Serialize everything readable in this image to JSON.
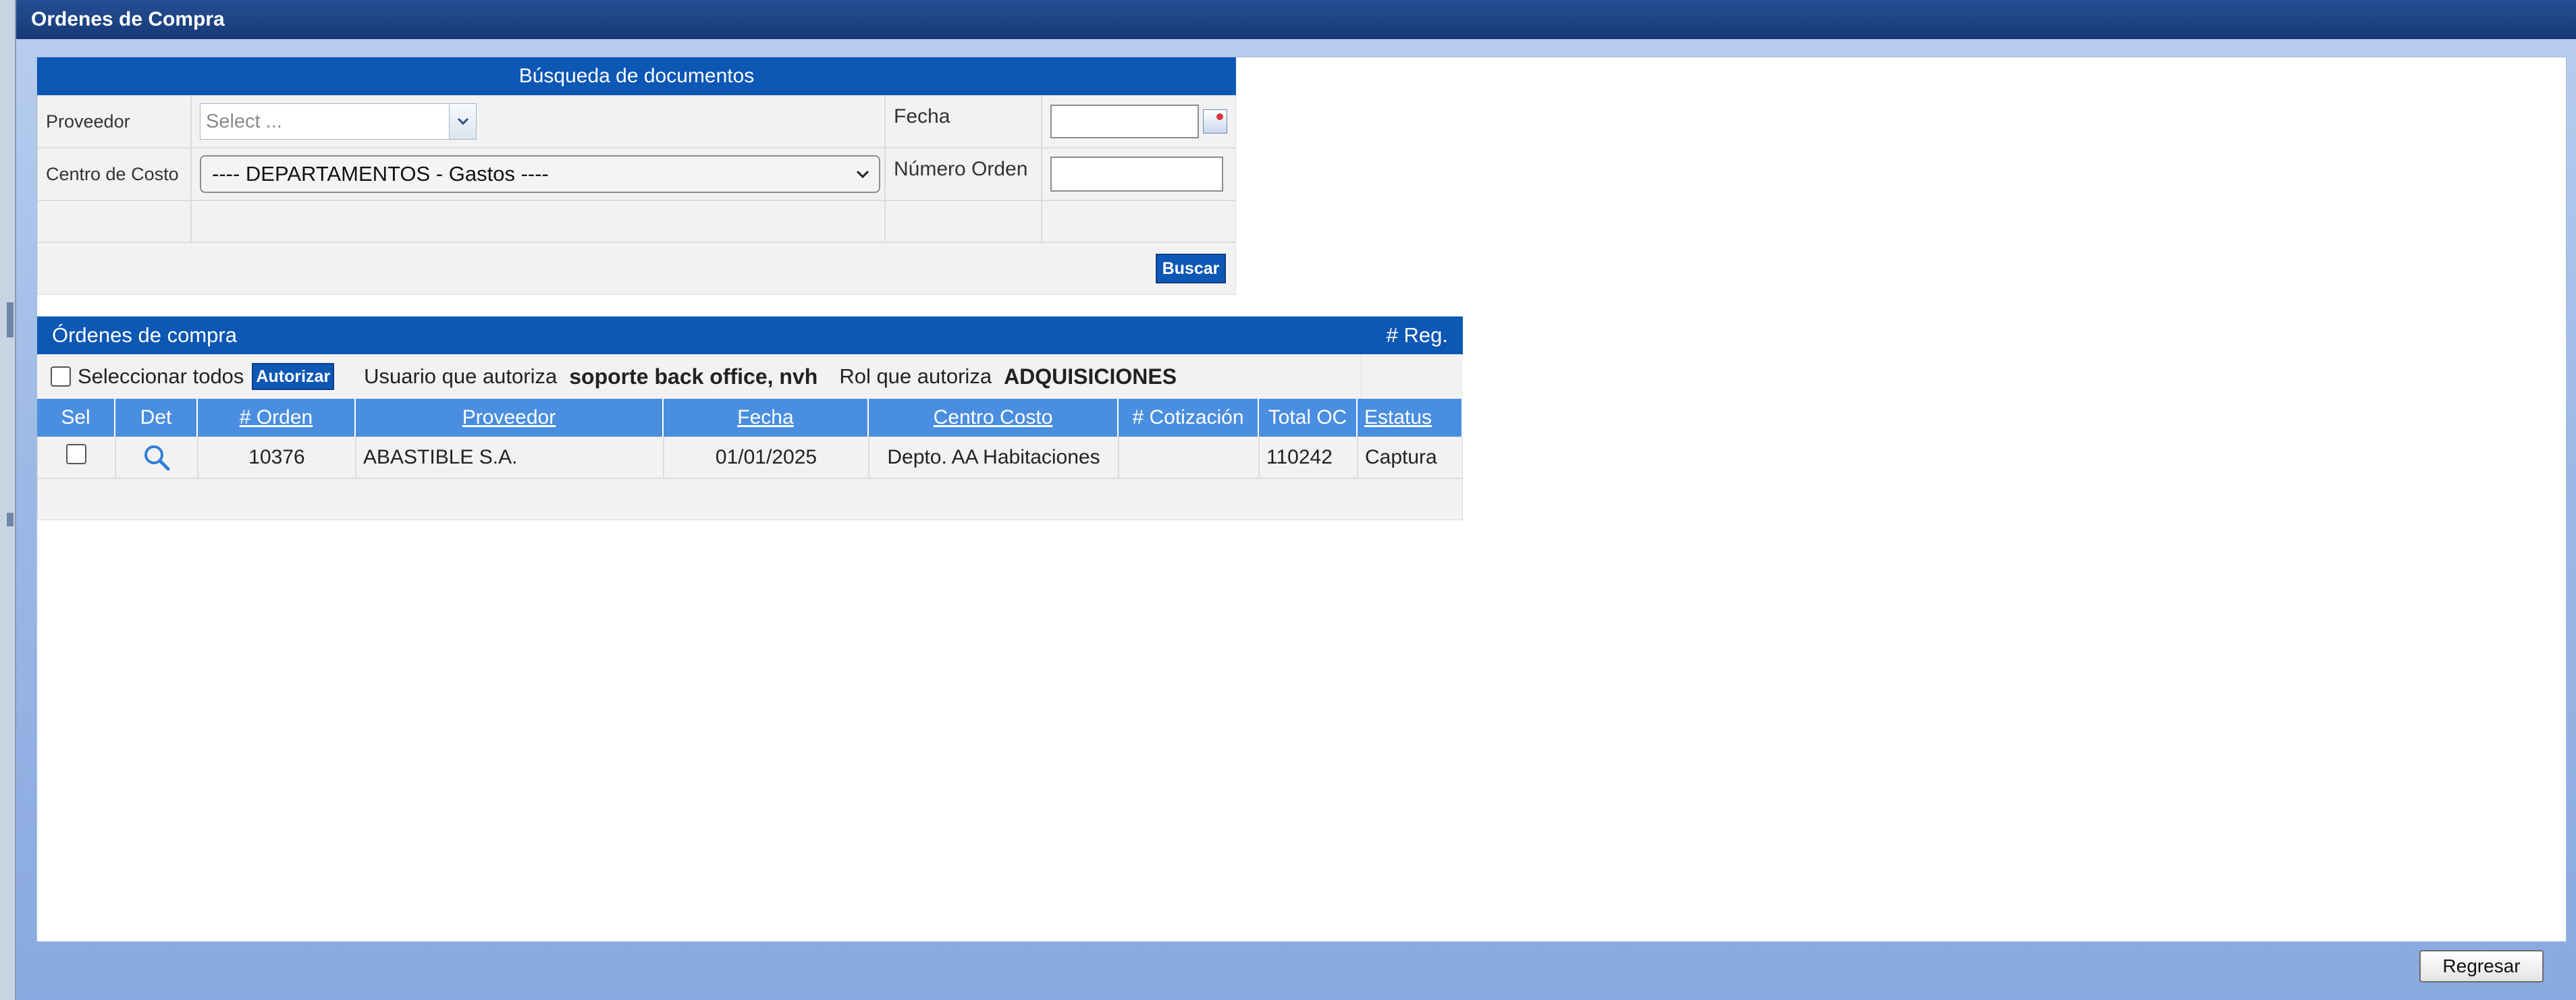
{
  "window": {
    "title": "Ordenes de Compra"
  },
  "search": {
    "title": "Búsqueda de documentos",
    "proveedor_label": "Proveedor",
    "proveedor_placeholder": "Select ...",
    "fecha_label": "Fecha",
    "fecha_value": "",
    "centro_costo_label": "Centro de Costo",
    "centro_costo_selected": "---- DEPARTAMENTOS - Gastos ----",
    "numero_orden_label": "Número Orden",
    "numero_orden_value": "",
    "buscar_label": "Buscar"
  },
  "results": {
    "title": "Órdenes de compra",
    "reg_label": "# Reg.",
    "select_all_label": "Seleccionar todos",
    "autorizar_label": "Autorizar",
    "usuario_caption": "Usuario que autoriza",
    "usuario_value": "soporte back office, nvh",
    "rol_caption": "Rol que autoriza",
    "rol_value": "ADQUISICIONES",
    "columns": [
      "Sel",
      "Det",
      "# Orden",
      "Proveedor",
      "Fecha",
      "Centro Costo",
      "# Cotización",
      "Total OC",
      "Estatus"
    ],
    "rows": [
      {
        "orden": "10376",
        "proveedor": "ABASTIBLE S.A.",
        "fecha": "01/01/2025",
        "centro_costo": "Depto. AA Habitaciones",
        "cotizacion": "",
        "total_oc": "110242",
        "estatus": "Captura"
      }
    ]
  },
  "footer": {
    "regresar_label": "Regresar"
  },
  "colors": {
    "header_blue": "#0d57b5",
    "column_header_blue": "#4a8ee0",
    "titlebar": "#173a76"
  }
}
